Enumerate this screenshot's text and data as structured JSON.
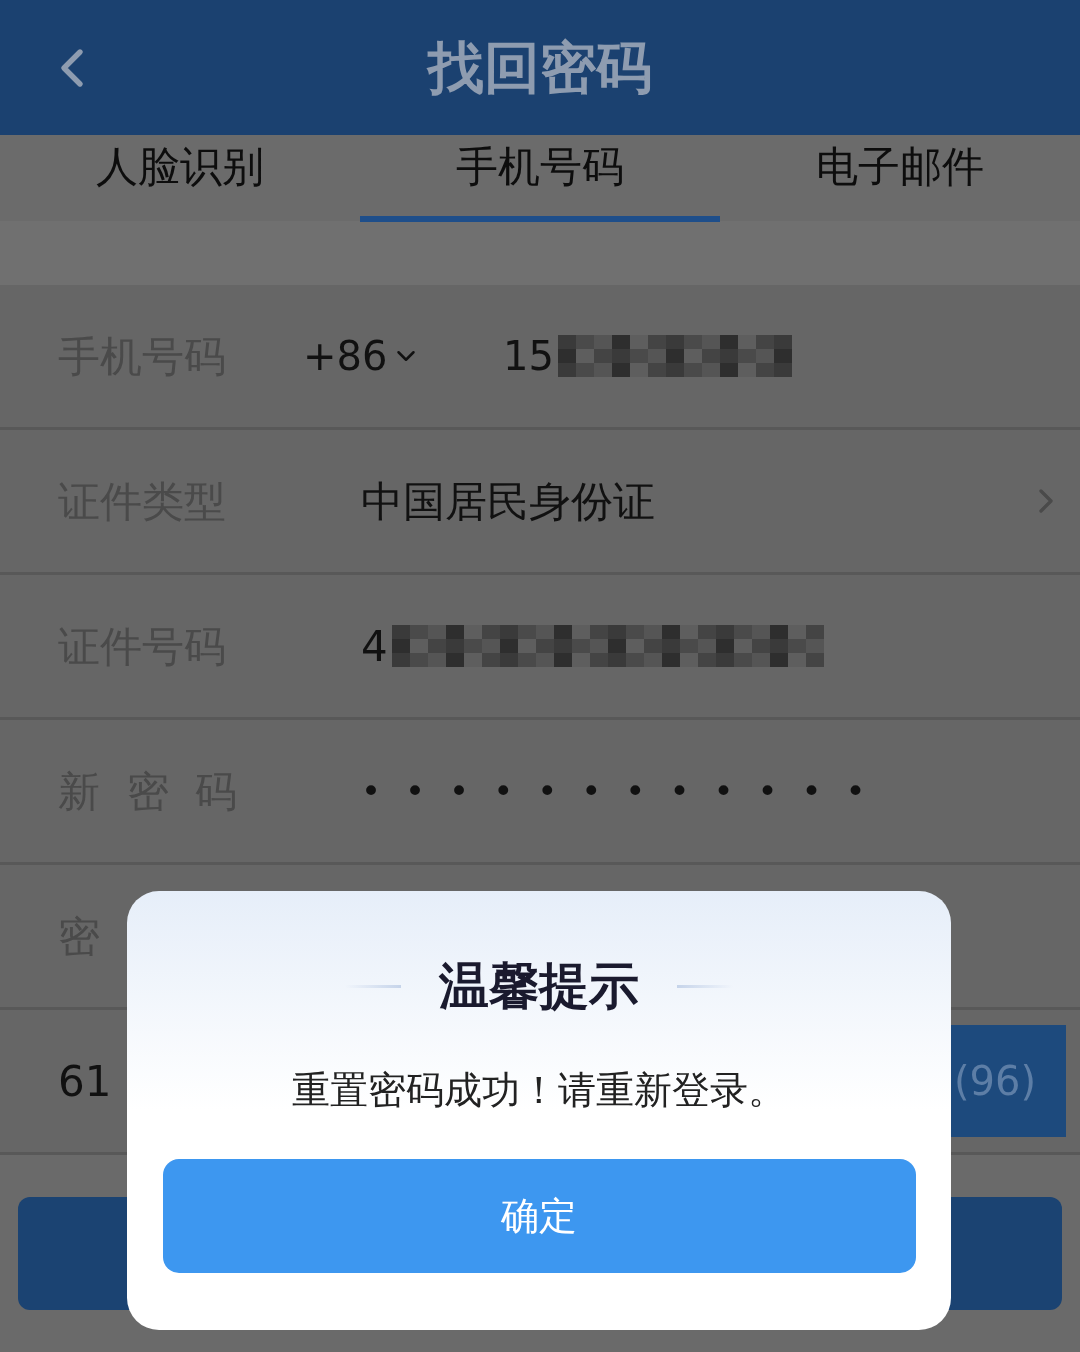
{
  "header": {
    "title": "找回密码"
  },
  "tabs": [
    {
      "label": "人脸识别",
      "selected": false
    },
    {
      "label": "手机号码",
      "selected": true
    },
    {
      "label": "电子邮件",
      "selected": false
    }
  ],
  "form": [
    {
      "kind": "phone",
      "label": "手机号码",
      "code": "+86",
      "value": "15"
    },
    {
      "kind": "select",
      "label": "证件类型",
      "value": "中国居民身份证"
    },
    {
      "kind": "redacted",
      "label": "证件号码",
      "value": "4"
    },
    {
      "kind": "password",
      "label": "新  密  码",
      "value": "••••••••••••"
    },
    {
      "kind": "plain",
      "label": "密"
    },
    {
      "kind": "sms",
      "value": "61",
      "button": "(96)"
    }
  ],
  "dialog": {
    "title": "温馨提示",
    "message": "重置密码成功！请重新登录。",
    "confirm": "确定"
  }
}
